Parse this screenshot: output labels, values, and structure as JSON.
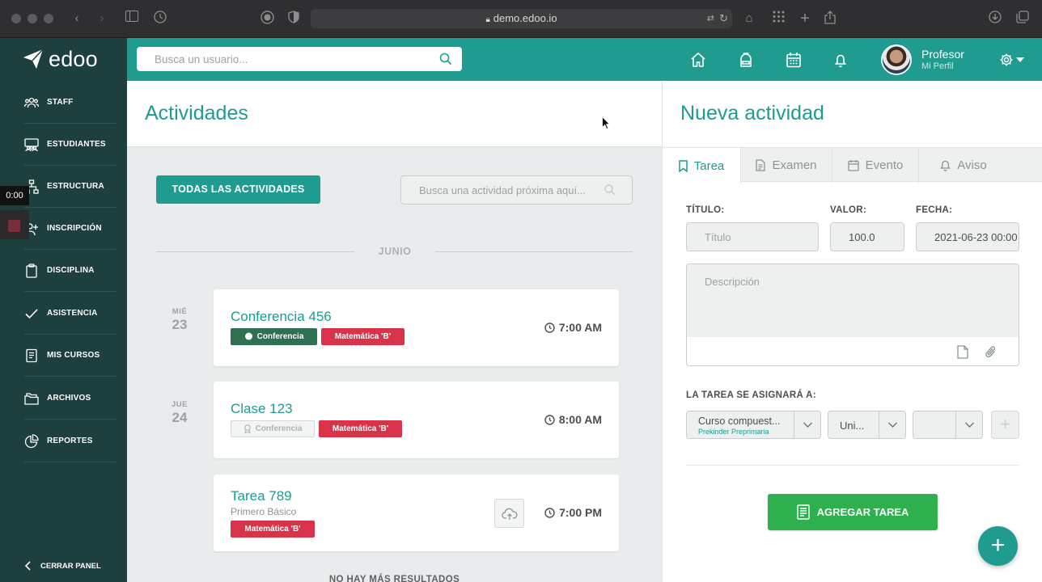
{
  "browser": {
    "url": "demo.edoo.io"
  },
  "sidebar": {
    "logo": "edoo",
    "items": [
      {
        "label": "STAFF",
        "icon": "staff-icon"
      },
      {
        "label": "ESTUDIANTES",
        "icon": "students-icon"
      },
      {
        "label": "ESTRUCTURA",
        "icon": "structure-icon"
      },
      {
        "label": "INSCRIPCIÓN",
        "icon": "enrollment-icon"
      },
      {
        "label": "DISCIPLINA",
        "icon": "clipboard-icon"
      },
      {
        "label": "ASISTENCIA",
        "icon": "check-icon"
      },
      {
        "label": "MIS CURSOS",
        "icon": "courses-icon"
      },
      {
        "label": "ARCHIVOS",
        "icon": "folders-icon"
      },
      {
        "label": "REPORTES",
        "icon": "reports-icon"
      }
    ],
    "collapse_label": "CERRAR PANEL"
  },
  "recorder": {
    "time": "0:00"
  },
  "topbar": {
    "search_placeholder": "Busca un usuario...",
    "profile_name": "Profesor",
    "profile_sub": "Mi Perfil"
  },
  "activities": {
    "title": "Actividades",
    "all_button": "TODAS LAS ACTIVIDADES",
    "search_placeholder": "Busca una actividad próxima aquí...",
    "month": "JUNIO",
    "days": [
      {
        "weekday": "MIÉ",
        "day": "23"
      },
      {
        "weekday": "JUE",
        "day": "24"
      }
    ],
    "cards": [
      {
        "title": "Conferencia 456",
        "tags": [
          "Conferencia",
          "Matemática 'B'"
        ],
        "time": "7:00 AM"
      },
      {
        "title": "Clase 123",
        "tags": [
          "Conferencia",
          "Matemática 'B'"
        ],
        "time": "8:00 AM"
      },
      {
        "title": "Tarea 789",
        "subtitle": "Primero Básico",
        "tags": [
          "Matemática 'B'"
        ],
        "time": "7:00 PM"
      }
    ],
    "no_more": "NO HAY MÁS RESULTADOS"
  },
  "new_activity": {
    "title": "Nueva actividad",
    "tabs": [
      "Tarea",
      "Examen",
      "Evento",
      "Aviso"
    ],
    "active_tab": "Tarea",
    "fields": {
      "title_label": "TÍTULO:",
      "title_placeholder": "Título",
      "value_label": "VALOR:",
      "value": "100.0",
      "date_label": "FECHA:",
      "date": "2021-06-23 00:00",
      "description_placeholder": "Descripción"
    },
    "assign_label": "LA TAREA SE ASIGNARÁ A:",
    "selects": [
      {
        "value": "Curso compuest...",
        "sub": "Prekinder Preprimaria"
      },
      {
        "value": "Uni..."
      },
      {
        "value": ""
      }
    ],
    "add_button": "AGREGAR TAREA"
  },
  "colors": {
    "teal": "#1f9b8f",
    "sidebar": "#1d3f3d",
    "green_button": "#2eb04f",
    "red_tag": "#d9334a",
    "green_tag": "#2f6f52"
  }
}
